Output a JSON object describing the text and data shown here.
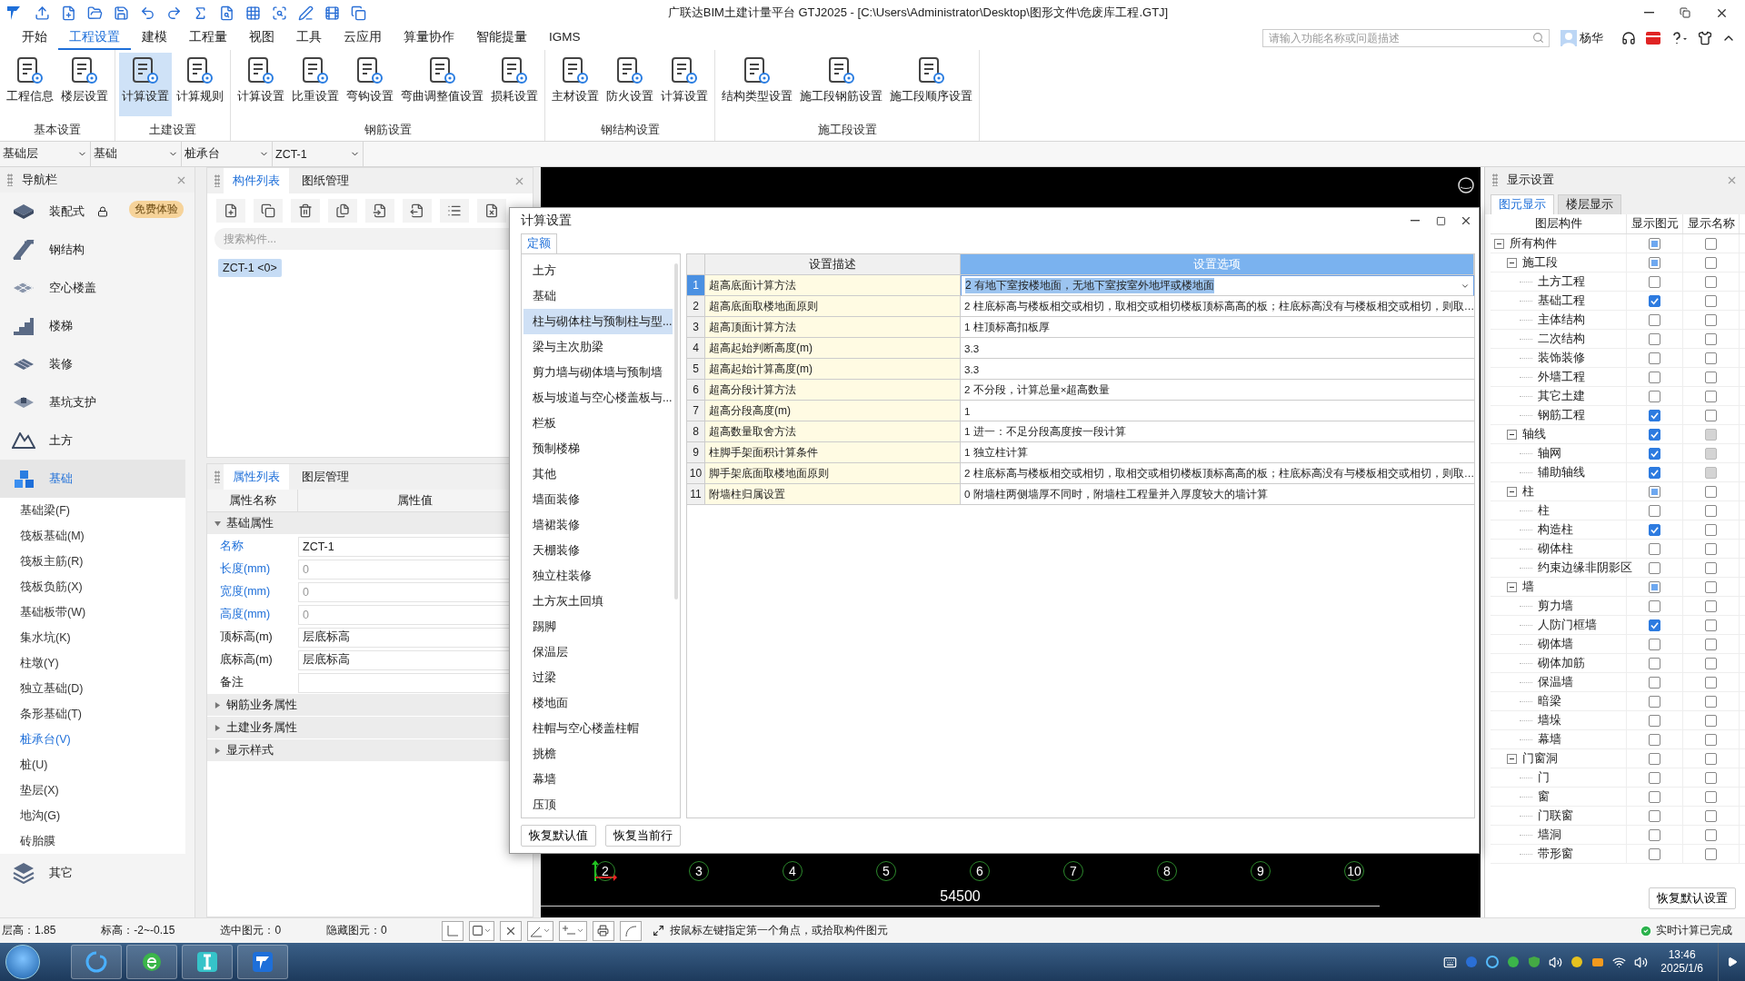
{
  "title_bar": {
    "title": "广联达BIM土建计量平台 GTJ2025 - [C:\\Users\\Administrator\\Desktop\\图形文件\\危废库工程.GTJ]"
  },
  "menu_tabs": [
    {
      "label": "开始",
      "selected": false
    },
    {
      "label": "工程设置",
      "selected": true
    },
    {
      "label": "建模",
      "selected": false
    },
    {
      "label": "工程量",
      "selected": false
    },
    {
      "label": "视图",
      "selected": false
    },
    {
      "label": "工具",
      "selected": false
    },
    {
      "label": "云应用",
      "selected": false
    },
    {
      "label": "算量协作",
      "selected": false
    },
    {
      "label": "智能提量",
      "selected": false
    },
    {
      "label": "IGMS",
      "selected": false
    }
  ],
  "search": {
    "placeholder": "请输入功能名称或问题描述"
  },
  "user": {
    "name": "杨华"
  },
  "ribbon_groups": [
    {
      "title": "基本设置",
      "buttons": [
        {
          "label": "工程信息",
          "selected": false
        },
        {
          "label": "楼层设置",
          "selected": false
        }
      ]
    },
    {
      "title": "土建设置",
      "buttons": [
        {
          "label": "计算设置",
          "selected": true
        },
        {
          "label": "计算规则",
          "selected": false
        }
      ]
    },
    {
      "title": "钢筋设置",
      "buttons": [
        {
          "label": "计算设置",
          "selected": false
        },
        {
          "label": "比重设置",
          "selected": false
        },
        {
          "label": "弯钩设置",
          "selected": false
        },
        {
          "label": "弯曲调整值设置",
          "selected": false
        },
        {
          "label": "损耗设置",
          "selected": false
        }
      ]
    },
    {
      "title": "钢结构设置",
      "buttons": [
        {
          "label": "主材设置",
          "selected": false
        },
        {
          "label": "防火设置",
          "selected": false
        },
        {
          "label": "计算设置",
          "selected": false
        }
      ]
    },
    {
      "title": "施工段设置",
      "buttons": [
        {
          "label": "结构类型设置",
          "selected": false
        },
        {
          "label": "施工段钢筋设置",
          "selected": false
        },
        {
          "label": "施工段顺序设置",
          "selected": false
        }
      ]
    }
  ],
  "selectors": [
    "基础层",
    "基础",
    "桩承台",
    "ZCT-1"
  ],
  "nav": {
    "title": "导航栏",
    "items": [
      {
        "label": "装配式",
        "selected": false,
        "locked": true,
        "badge": "免费体验"
      },
      {
        "label": "钢结构",
        "selected": false
      },
      {
        "label": "空心楼盖",
        "selected": false
      },
      {
        "label": "楼梯",
        "selected": false
      },
      {
        "label": "装修",
        "selected": false
      },
      {
        "label": "基坑支护",
        "selected": false
      },
      {
        "label": "土方",
        "selected": false
      },
      {
        "label": "基础",
        "selected": true,
        "children": [
          {
            "label": "基础梁(F)",
            "selected": false
          },
          {
            "label": "筏板基础(M)",
            "selected": false
          },
          {
            "label": "筏板主筋(R)",
            "selected": false
          },
          {
            "label": "筏板负筋(X)",
            "selected": false
          },
          {
            "label": "基础板带(W)",
            "selected": false
          },
          {
            "label": "集水坑(K)",
            "selected": false
          },
          {
            "label": "柱墩(Y)",
            "selected": false
          },
          {
            "label": "独立基础(D)",
            "selected": false
          },
          {
            "label": "条形基础(T)",
            "selected": false
          },
          {
            "label": "桩承台(V)",
            "selected": true
          },
          {
            "label": "桩(U)",
            "selected": false
          },
          {
            "label": "垫层(X)",
            "selected": false
          },
          {
            "label": "地沟(G)",
            "selected": false
          },
          {
            "label": "砖胎膜",
            "selected": false
          }
        ]
      },
      {
        "label": "其它",
        "selected": false
      }
    ]
  },
  "component_panel": {
    "tabs": [
      {
        "label": "构件列表",
        "selected": true
      },
      {
        "label": "图纸管理",
        "selected": false
      }
    ],
    "search": {
      "placeholder": "搜索构件..."
    },
    "items": [
      {
        "label": "ZCT-1 <0>",
        "selected": true
      }
    ]
  },
  "property_panel": {
    "tabs": [
      {
        "label": "属性列表",
        "selected": true
      },
      {
        "label": "图层管理",
        "selected": false
      }
    ],
    "columns": [
      "属性名称",
      "属性值"
    ],
    "groups": [
      {
        "label": "基础属性",
        "expanded": true,
        "rows": [
          {
            "name": "名称",
            "value": "ZCT-1",
            "public": true,
            "disabled": false
          },
          {
            "name": "长度(mm)",
            "value": "0",
            "public": true,
            "disabled": true
          },
          {
            "name": "宽度(mm)",
            "value": "0",
            "public": true,
            "disabled": true
          },
          {
            "name": "高度(mm)",
            "value": "0",
            "public": true,
            "disabled": true
          },
          {
            "name": "顶标高(m)",
            "value": "层底标高",
            "public": false,
            "disabled": false
          },
          {
            "name": "底标高(m)",
            "value": "层底标高",
            "public": false,
            "disabled": false
          },
          {
            "name": "备注",
            "public": false,
            "disabled": false
          }
        ]
      },
      {
        "label": "钢筋业务属性",
        "expanded": false
      },
      {
        "label": "土建业务属性",
        "expanded": false
      },
      {
        "label": "显示样式",
        "expanded": false
      }
    ]
  },
  "canvas": {
    "axes": [
      "2",
      "3",
      "4",
      "5",
      "6",
      "7",
      "8",
      "9",
      "10"
    ],
    "dimension": "54500"
  },
  "dialog": {
    "title": "计算设置",
    "tabs": [
      {
        "label": "定额",
        "selected": true
      }
    ],
    "categories": [
      {
        "label": "土方",
        "selected": false
      },
      {
        "label": "基础",
        "selected": false
      },
      {
        "label": "柱与砌体柱与预制柱与型...",
        "selected": true
      },
      {
        "label": "梁与主次肋梁",
        "selected": false
      },
      {
        "label": "剪力墙与砌体墙与预制墙",
        "selected": false
      },
      {
        "label": "板与坡道与空心楼盖板与...",
        "selected": false
      },
      {
        "label": "栏板",
        "selected": false
      },
      {
        "label": "预制楼梯",
        "selected": false
      },
      {
        "label": "其他",
        "selected": false
      },
      {
        "label": "墙面装修",
        "selected": false
      },
      {
        "label": "墙裙装修",
        "selected": false
      },
      {
        "label": "天棚装修",
        "selected": false
      },
      {
        "label": "独立柱装修",
        "selected": false
      },
      {
        "label": "土方灰土回填",
        "selected": false
      },
      {
        "label": "踢脚",
        "selected": false
      },
      {
        "label": "保温层",
        "selected": false
      },
      {
        "label": "过梁",
        "selected": false
      },
      {
        "label": "楼地面",
        "selected": false
      },
      {
        "label": "柱帽与空心楼盖柱帽",
        "selected": false
      },
      {
        "label": "挑檐",
        "selected": false
      },
      {
        "label": "幕墙",
        "selected": false
      },
      {
        "label": "压顶",
        "selected": false
      }
    ],
    "columns": [
      {
        "label": "设置描述",
        "selected": false
      },
      {
        "label": "设置选项",
        "selected": true
      }
    ],
    "rows": [
      {
        "no": "1",
        "description": "超高底面计算方法",
        "option": "2 有地下室按楼地面，无地下室按室外地坪或楼地面",
        "selected": true
      },
      {
        "no": "2",
        "description": "超高底面取楼地面原则",
        "option": "2 柱底标高与楼板相交或相切，取相交或相切楼板顶标高高的板；柱底标高没有与楼板相交或相切，则取…",
        "selected": false
      },
      {
        "no": "3",
        "description": "超高顶面计算方法",
        "option": "1 柱顶标高扣板厚",
        "selected": false
      },
      {
        "no": "4",
        "description": "超高起始判断高度(m)",
        "option": "3.3",
        "selected": false
      },
      {
        "no": "5",
        "description": "超高起始计算高度(m)",
        "option": "3.3",
        "selected": false
      },
      {
        "no": "6",
        "description": "超高分段计算方法",
        "option": "2 不分段，计算总量×超高数量",
        "selected": false
      },
      {
        "no": "7",
        "description": "超高分段高度(m)",
        "option": "1",
        "selected": false
      },
      {
        "no": "8",
        "description": "超高数量取舍方法",
        "option": "1 进一：不足分段高度按一段计算",
        "selected": false
      },
      {
        "no": "9",
        "description": "柱脚手架面积计算条件",
        "option": "1 独立柱计算",
        "selected": false
      },
      {
        "no": "10",
        "description": "脚手架底面取楼地面原则",
        "option": "2 柱底标高与楼板相交或相切，取相交或相切楼板顶标高高的板；柱底标高没有与楼板相交或相切，则取…",
        "selected": false
      },
      {
        "no": "11",
        "description": "附墙柱归属设置",
        "option": "0 附墙柱两侧墙厚不同时，附墙柱工程量并入厚度较大的墙计算",
        "selected": false
      }
    ],
    "buttons": [
      "恢复默认值",
      "恢复当前行"
    ]
  },
  "display_panel": {
    "title": "显示设置",
    "tabs": [
      {
        "label": "图元显示",
        "selected": true
      },
      {
        "label": "楼层显示",
        "selected": false
      }
    ],
    "columns": [
      "图层构件",
      "显示图元",
      "显示名称"
    ],
    "tree": [
      {
        "label": "所有构件",
        "shown": false,
        "partial": true,
        "name_shown": false,
        "name_disabled": false,
        "expanded": true,
        "children": [
          {
            "label": "施工段",
            "shown": false,
            "partial": true,
            "name_shown": false,
            "name_disabled": false,
            "expanded": true,
            "children": [
              {
                "label": "土方工程",
                "shown": false,
                "partial": false,
                "name_shown": false,
                "name_disabled": false
              },
              {
                "label": "基础工程",
                "shown": true,
                "partial": false,
                "name_shown": false,
                "name_disabled": false
              },
              {
                "label": "主体结构",
                "shown": false,
                "partial": false,
                "name_shown": false,
                "name_disabled": false
              },
              {
                "label": "二次结构",
                "shown": false,
                "partial": false,
                "name_shown": false,
                "name_disabled": false
              },
              {
                "label": "装饰装修",
                "shown": false,
                "partial": false,
                "name_shown": false,
                "name_disabled": false
              },
              {
                "label": "外墙工程",
                "shown": false,
                "partial": false,
                "name_shown": false,
                "name_disabled": false
              },
              {
                "label": "其它土建",
                "shown": false,
                "partial": false,
                "name_shown": false,
                "name_disabled": false
              },
              {
                "label": "钢筋工程",
                "shown": true,
                "partial": false,
                "name_shown": false,
                "name_disabled": false
              }
            ]
          },
          {
            "label": "轴线",
            "shown": true,
            "partial": false,
            "name_shown": false,
            "name_disabled": true,
            "expanded": true,
            "children": [
              {
                "label": "轴网",
                "shown": true,
                "partial": false,
                "name_shown": false,
                "name_disabled": true
              },
              {
                "label": "辅助轴线",
                "shown": true,
                "partial": false,
                "name_shown": false,
                "name_disabled": true
              }
            ]
          },
          {
            "label": "柱",
            "shown": false,
            "partial": true,
            "name_shown": false,
            "name_disabled": false,
            "expanded": true,
            "children": [
              {
                "label": "柱",
                "shown": false,
                "partial": false,
                "name_shown": false,
                "name_disabled": false
              },
              {
                "label": "构造柱",
                "shown": true,
                "partial": false,
                "name_shown": false,
                "name_disabled": false
              },
              {
                "label": "砌体柱",
                "shown": false,
                "partial": false,
                "name_shown": false,
                "name_disabled": false
              },
              {
                "label": "约束边缘非阴影区",
                "shown": false,
                "partial": false,
                "name_shown": false,
                "name_disabled": false
              }
            ]
          },
          {
            "label": "墙",
            "shown": false,
            "partial": true,
            "name_shown": false,
            "name_disabled": false,
            "expanded": true,
            "children": [
              {
                "label": "剪力墙",
                "shown": false,
                "partial": false,
                "name_shown": false,
                "name_disabled": false
              },
              {
                "label": "人防门框墙",
                "shown": true,
                "partial": false,
                "name_shown": false,
                "name_disabled": false
              },
              {
                "label": "砌体墙",
                "shown": false,
                "partial": false,
                "name_shown": false,
                "name_disabled": false
              },
              {
                "label": "砌体加筋",
                "shown": false,
                "partial": false,
                "name_shown": false,
                "name_disabled": false
              },
              {
                "label": "保温墙",
                "shown": false,
                "partial": false,
                "name_shown": false,
                "name_disabled": false
              },
              {
                "label": "暗梁",
                "shown": false,
                "partial": false,
                "name_shown": false,
                "name_disabled": false
              },
              {
                "label": "墙垛",
                "shown": false,
                "partial": false,
                "name_shown": false,
                "name_disabled": false
              },
              {
                "label": "幕墙",
                "shown": false,
                "partial": false,
                "name_shown": false,
                "name_disabled": false
              }
            ]
          },
          {
            "label": "门窗洞",
            "shown": false,
            "partial": false,
            "name_shown": false,
            "name_disabled": false,
            "expanded": true,
            "children": [
              {
                "label": "门",
                "shown": false,
                "partial": false,
                "name_shown": false,
                "name_disabled": false
              },
              {
                "label": "窗",
                "shown": false,
                "partial": false,
                "name_shown": false,
                "name_disabled": false
              },
              {
                "label": "门联窗",
                "shown": false,
                "partial": false,
                "name_shown": false,
                "name_disabled": false
              },
              {
                "label": "墙洞",
                "shown": false,
                "partial": false,
                "name_shown": false,
                "name_disabled": false
              },
              {
                "label": "带形窗",
                "shown": false,
                "partial": false,
                "name_shown": false,
                "name_disabled": false
              }
            ]
          }
        ]
      }
    ],
    "button": "恢复默认设置"
  },
  "status_bar": {
    "items": [
      "层高：1.85",
      "标高：-2~-0.15",
      "选中图元：0",
      "隐藏图元：0"
    ],
    "hint": "按鼠标左键指定第一个角点，或拾取构件图元",
    "status": "实时计算已完成"
  },
  "taskbar": {
    "time": "13:46",
    "date": "2025/1/6"
  }
}
